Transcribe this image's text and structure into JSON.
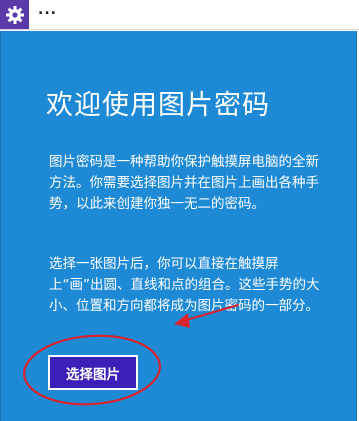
{
  "window": {
    "app_icon": "gear-icon",
    "menu_dots": "..."
  },
  "page": {
    "title": "欢迎使用图片密码",
    "paragraph1": "图片密码是一种帮助你保护触摸屏电脑的全新方法。你需要选择图片并在图片上画出各种手势，以此来创建你独一无二的密码。",
    "paragraph2": "选择一张图片后，你可以直接在触摸屏上“画”出圆、直线和点的组合。这些手势的大小、位置和方向都将成为图片密码的一部分。",
    "select_button_label": "选择图片"
  },
  "colors": {
    "panel_background": "#1e8ad6",
    "button_background": "#3b1fb8",
    "annotation_red": "#d9232e",
    "app_icon_background": "#5a3aa8"
  },
  "annotations": {
    "circle_around_button": true,
    "arrow_pointing_to_text_end": true
  }
}
